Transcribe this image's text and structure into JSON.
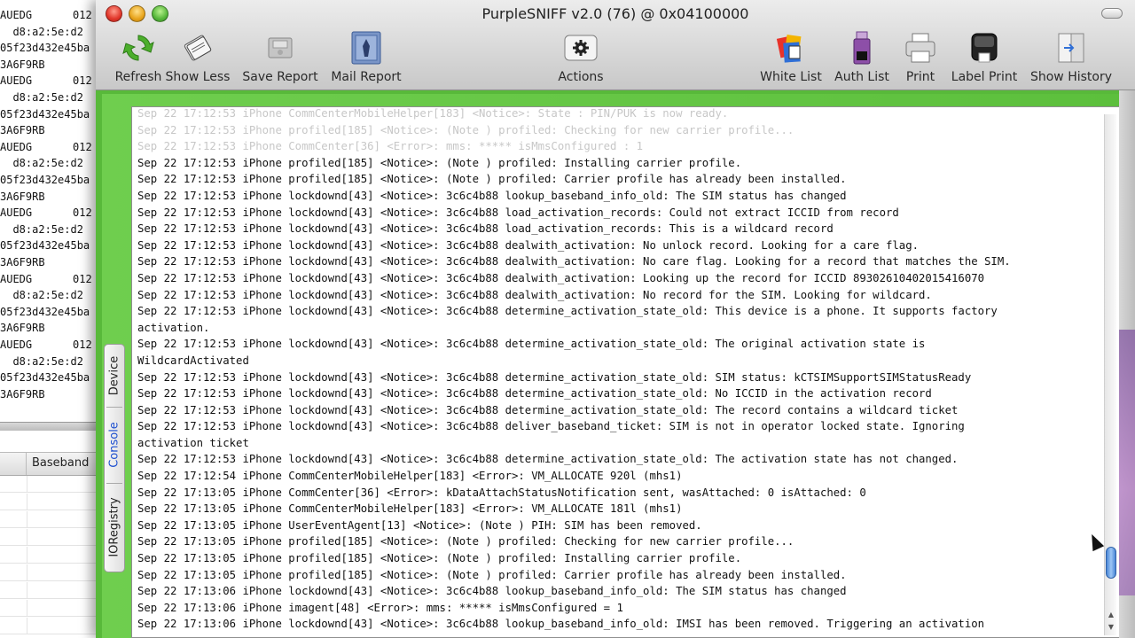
{
  "background_window": {
    "lines": [
      {
        "left": "AUEDG",
        "right": "012"
      },
      {
        "left": "  d8:a2:5e:d2",
        "right": ""
      },
      {
        "left": "05f23d432e45ba",
        "right": ""
      },
      {
        "left": "3A6F9RB",
        "right": ""
      },
      {
        "left": "AUEDG",
        "right": "012"
      },
      {
        "left": "  d8:a2:5e:d2",
        "right": ""
      },
      {
        "left": "05f23d432e45ba",
        "right": ""
      },
      {
        "left": "3A6F9RB",
        "right": ""
      },
      {
        "left": "AUEDG",
        "right": "012"
      },
      {
        "left": "  d8:a2:5e:d2",
        "right": ""
      },
      {
        "left": "05f23d432e45ba",
        "right": ""
      },
      {
        "left": "3A6F9RB",
        "right": ""
      },
      {
        "left": "AUEDG",
        "right": "012"
      },
      {
        "left": "  d8:a2:5e:d2",
        "right": ""
      },
      {
        "left": "05f23d432e45ba",
        "right": ""
      },
      {
        "left": "3A6F9RB",
        "right": ""
      },
      {
        "left": "AUEDG",
        "right": "012"
      },
      {
        "left": "  d8:a2:5e:d2",
        "right": ""
      },
      {
        "left": "05f23d432e45ba",
        "right": ""
      },
      {
        "left": "3A6F9RB",
        "right": ""
      },
      {
        "left": "AUEDG",
        "right": "012"
      },
      {
        "left": "  d8:a2:5e:d2",
        "right": ""
      },
      {
        "left": "05f23d432e45ba",
        "right": ""
      },
      {
        "left": "3A6F9RB",
        "right": ""
      }
    ],
    "table_header": "Baseband"
  },
  "window": {
    "title": "PurpleSNIFF v2.0 (76) @ 0x04100000"
  },
  "toolbar": {
    "refresh": "Refresh",
    "show_less": "Show Less",
    "save_report": "Save Report",
    "mail_report": "Mail Report",
    "actions": "Actions",
    "white_list": "White List",
    "auth_list": "Auth List",
    "print": "Print",
    "label_print": "Label Print",
    "show_history": "Show History"
  },
  "side_tabs": {
    "device": "Device",
    "console": "Console",
    "ioregistry": "IORegistry",
    "selected": "console"
  },
  "console": {
    "faded_lines": [
      "Sep 22 17:12:53 iPhone CommCenterMobileHelper[183] <Notice>: State : PIN/PUK is now ready.",
      "Sep 22 17:12:53 iPhone profiled[185] <Notice>: (Note ) profiled: Checking for new carrier profile...",
      "Sep 22 17:12:53 iPhone CommCenter[36] <Error>: mms: ***** isMmsConfigured : 1"
    ],
    "lines": [
      "Sep 22 17:12:53 iPhone profiled[185] <Notice>: (Note ) profiled: Installing carrier profile.",
      "Sep 22 17:12:53 iPhone profiled[185] <Notice>: (Note ) profiled: Carrier profile has already been installed.",
      "Sep 22 17:12:53 iPhone lockdownd[43] <Notice>: 3c6c4b88 lookup_baseband_info_old: The SIM status has changed",
      "Sep 22 17:12:53 iPhone lockdownd[43] <Notice>: 3c6c4b88 load_activation_records: Could not extract ICCID from record",
      "Sep 22 17:12:53 iPhone lockdownd[43] <Notice>: 3c6c4b88 load_activation_records: This is a wildcard record",
      "Sep 22 17:12:53 iPhone lockdownd[43] <Notice>: 3c6c4b88 dealwith_activation: No unlock record. Looking for a care flag.",
      "Sep 22 17:12:53 iPhone lockdownd[43] <Notice>: 3c6c4b88 dealwith_activation: No care flag. Looking for a record that matches the SIM.",
      "Sep 22 17:12:53 iPhone lockdownd[43] <Notice>: 3c6c4b88 dealwith_activation: Looking up the record for ICCID 89302610402015416070",
      "Sep 22 17:12:53 iPhone lockdownd[43] <Notice>: 3c6c4b88 dealwith_activation: No record for the SIM. Looking for wildcard.",
      "Sep 22 17:12:53 iPhone lockdownd[43] <Notice>: 3c6c4b88 determine_activation_state_old: This device is a phone. It supports factory",
      "activation.",
      "Sep 22 17:12:53 iPhone lockdownd[43] <Notice>: 3c6c4b88 determine_activation_state_old: The original activation state is",
      "WildcardActivated",
      "Sep 22 17:12:53 iPhone lockdownd[43] <Notice>: 3c6c4b88 determine_activation_state_old: SIM status: kCTSIMSupportSIMStatusReady",
      "Sep 22 17:12:53 iPhone lockdownd[43] <Notice>: 3c6c4b88 determine_activation_state_old: No ICCID in the activation record",
      "Sep 22 17:12:53 iPhone lockdownd[43] <Notice>: 3c6c4b88 determine_activation_state_old: The record contains a wildcard ticket",
      "Sep 22 17:12:53 iPhone lockdownd[43] <Notice>: 3c6c4b88 deliver_baseband_ticket: SIM is not in operator locked state. Ignoring",
      "activation ticket",
      "Sep 22 17:12:53 iPhone lockdownd[43] <Notice>: 3c6c4b88 determine_activation_state_old: The activation state has not changed.",
      "Sep 22 17:12:54 iPhone CommCenterMobileHelper[183] <Error>: VM_ALLOCATE 920l (mhs1)",
      "Sep 22 17:13:05 iPhone CommCenter[36] <Error>: kDataAttachStatusNotification sent, wasAttached: 0 isAttached: 0",
      "Sep 22 17:13:05 iPhone CommCenterMobileHelper[183] <Error>: VM_ALLOCATE 181l (mhs1)",
      "Sep 22 17:13:05 iPhone UserEventAgent[13] <Notice>: (Note ) PIH: SIM has been removed.",
      "Sep 22 17:13:05 iPhone profiled[185] <Notice>: (Note ) profiled: Checking for new carrier profile...",
      "Sep 22 17:13:05 iPhone profiled[185] <Notice>: (Note ) profiled: Installing carrier profile.",
      "Sep 22 17:13:05 iPhone profiled[185] <Notice>: (Note ) profiled: Carrier profile has already been installed.",
      "Sep 22 17:13:06 iPhone lockdownd[43] <Notice>: 3c6c4b88 lookup_baseband_info_old: The SIM status has changed",
      "Sep 22 17:13:06 iPhone imagent[48] <Error>: mms: ***** isMmsConfigured = 1",
      "Sep 22 17:13:06 iPhone lockdownd[43] <Notice>: 3c6c4b88 lookup_baseband_info_old: IMSI has been removed. Triggering an activation"
    ]
  },
  "colors": {
    "green_panel": "#58b93a",
    "selected_tab": "#1d4fd0"
  }
}
